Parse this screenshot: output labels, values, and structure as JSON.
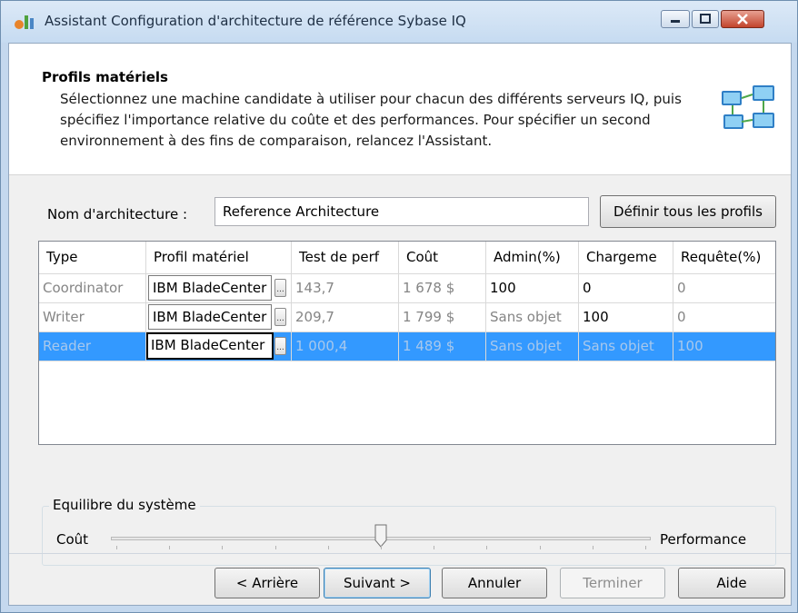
{
  "window": {
    "title": "Assistant Configuration d'architecture de référence Sybase IQ",
    "icon": "wizard-icon"
  },
  "header": {
    "title": "Profils matériels",
    "description": "Sélectionnez une machine candidate à utiliser pour chacun des différents serveurs IQ, puis spécifiez l'importance relative du coûte et des performances. Pour spécifier un second environnement à des fins de comparaison, relancez l'Assistant.",
    "icon": "servers-network-icon"
  },
  "form": {
    "name_label": "Nom d'architecture :",
    "name_value": "Reference Architecture",
    "define_profiles_label": "Définir tous les profils"
  },
  "grid": {
    "columns": [
      "Type",
      "Profil matériel",
      "Test de perf",
      "Coût",
      "Admin(%)",
      "Chargeme",
      "Requête(%)"
    ],
    "rows": [
      {
        "type": "Coordinator",
        "profile": "IBM BladeCenter",
        "perf": "143,7",
        "cost": "1 678 $",
        "admin": "100",
        "charge": "0",
        "requete": "0"
      },
      {
        "type": "Writer",
        "profile": "IBM BladeCenter",
        "perf": "209,7",
        "cost": "1 799 $",
        "admin": "Sans objet",
        "charge": "100",
        "requete": "0"
      },
      {
        "type": "Reader",
        "profile": "IBM BladeCenter",
        "perf": "1 000,4",
        "cost": "1 489 $",
        "admin": "Sans objet",
        "charge": "Sans objet",
        "requete": "100"
      }
    ],
    "selected_row": 2,
    "ellipsis": "..."
  },
  "balance": {
    "title": "Equilibre du système",
    "left_label": "Coût",
    "right_label": "Performance",
    "value": 0.5
  },
  "buttons": {
    "back": "< Arrière",
    "next": "Suivant >",
    "cancel": "Annuler",
    "finish": "Terminer",
    "help": "Aide"
  },
  "colors": {
    "selection": "#3399ff",
    "titlebar": "#c6dbf1",
    "close": "#c2442c"
  }
}
